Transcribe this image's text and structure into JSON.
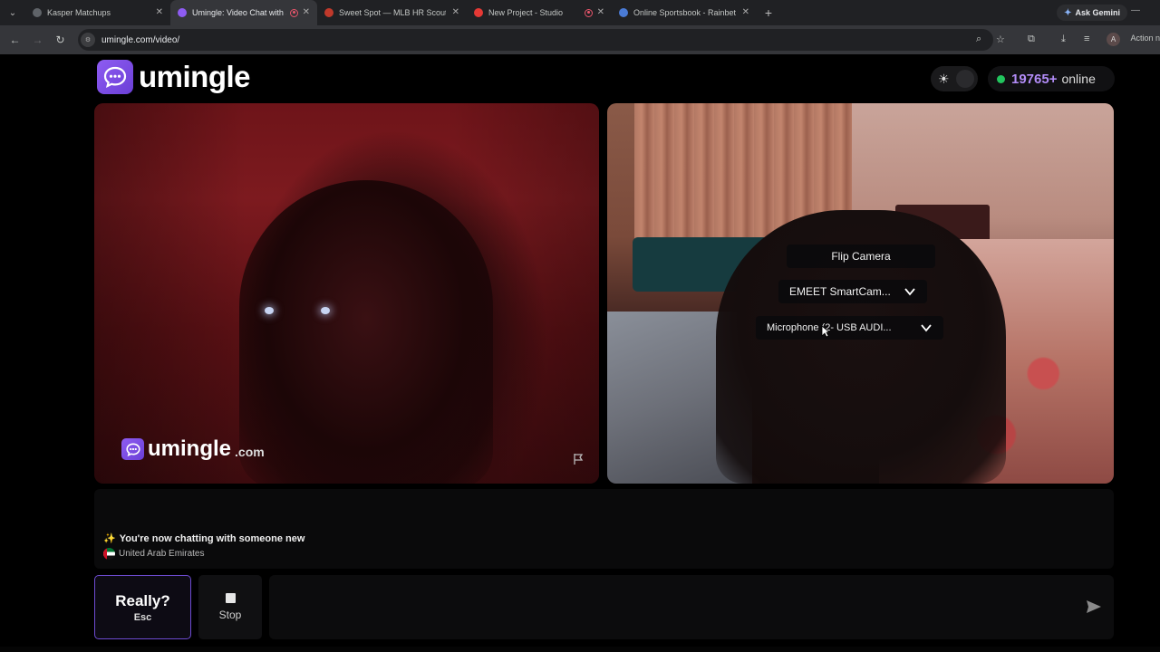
{
  "browser": {
    "tabs": [
      {
        "title": "Kasper Matchups",
        "fav_color": "#5f6368",
        "active": false
      },
      {
        "title": "Umingle: Video Chat with S",
        "fav_color": "#8e5cf2",
        "active": true
      },
      {
        "title": "Sweet Spot — MLB HR Scoutin",
        "fav_color": "#c0392b",
        "active": false
      },
      {
        "title": "New Project - Studio",
        "fav_color": "#e53935",
        "active": false
      },
      {
        "title": "",
        "fav_color": "#e53935",
        "active": false
      },
      {
        "title": "Online Sportsbook - Rainbet",
        "fav_color": "#4a7bd6",
        "active": false
      }
    ],
    "gemini_label": "Ask Gemini",
    "url": "umingle.com/video/",
    "action_label": "Action n",
    "avatar_letter": "A"
  },
  "header": {
    "logo_text": "umingle",
    "online_count": "19765+",
    "online_label": "online"
  },
  "stranger_video": {
    "watermark_name": "umingle",
    "watermark_tld": ".com"
  },
  "self_video": {
    "flip_label": "Flip Camera",
    "camera_select": "EMEET SmartCam...",
    "mic_select": "Microphone (2- USB AUDI..."
  },
  "chat": {
    "status_text": "You're now chatting with someone new",
    "country": "United Arab Emirates",
    "input_placeholder": ""
  },
  "controls": {
    "really_label": "Really?",
    "really_hint": "Esc",
    "stop_label": "Stop"
  },
  "colors": {
    "brand": "#8e5cf2",
    "online_dot": "#22c55e",
    "count": "#b28cf7"
  }
}
